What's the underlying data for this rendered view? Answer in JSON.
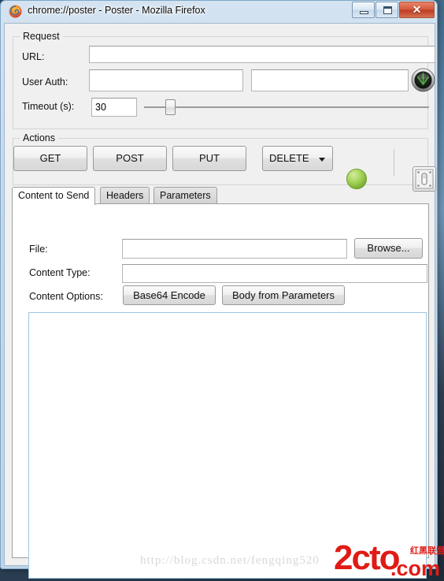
{
  "window": {
    "title": "chrome://poster - Poster - Mozilla Firefox",
    "app_icon": "firefox-icon",
    "controls": {
      "minimize": "minimize-icon",
      "maximize": "maximize-icon",
      "close_glyph": "✕"
    }
  },
  "request": {
    "group_title": "Request",
    "url_label": "URL:",
    "url_value": "",
    "url_placeholder": "",
    "auth_label": "User Auth:",
    "auth_user_value": "",
    "auth_pass_value": "",
    "timeout_label": "Timeout (s):",
    "timeout_value": "30",
    "timeout_slider_percent": 8,
    "globe_icon": "radar-globe-icon"
  },
  "actions": {
    "group_title": "Actions",
    "get_label": "GET",
    "post_label": "POST",
    "put_label": "PUT",
    "delete_label": "DELETE",
    "status_indicator": "green-ball-icon",
    "status_color": "#a7d45c",
    "switch_icon": "light-switch-icon"
  },
  "tabs": [
    {
      "label": "Content to Send",
      "active": true
    },
    {
      "label": "Headers",
      "active": false
    },
    {
      "label": "Parameters",
      "active": false
    }
  ],
  "content_to_send": {
    "file_label": "File:",
    "file_value": "",
    "browse_label": "Browse...",
    "content_type_label": "Content Type:",
    "content_type_value": "",
    "content_options_label": "Content Options:",
    "base64_label": "Base64 Encode",
    "body_from_params_label": "Body from Parameters",
    "body_value": ""
  },
  "watermark": {
    "url": "http://blog.csdn.net/fengqing520",
    "logo_text": "2cto",
    "logo_tld": ".com",
    "logo_cn": "红黑联盟",
    "logo_color": "#e01b16"
  }
}
